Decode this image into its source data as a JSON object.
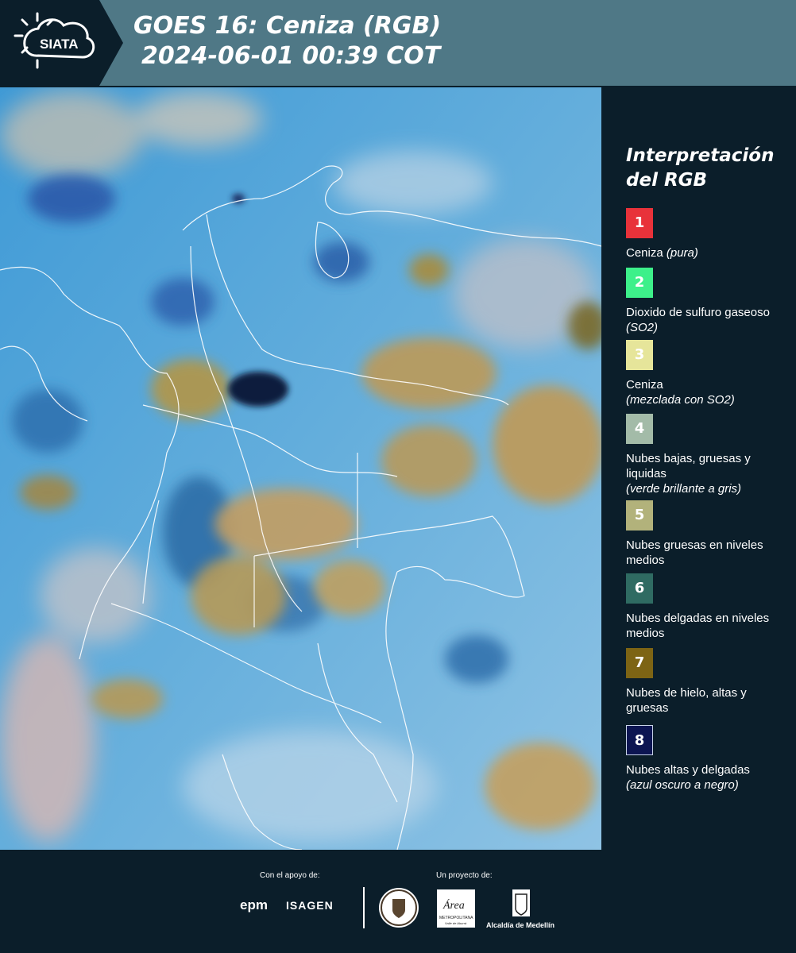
{
  "header": {
    "logo_text": "SIATA",
    "title_line1": "GOES 16: Ceniza (RGB)",
    "title_line2": "2024-06-01 00:39 COT"
  },
  "legend": {
    "title_line1": "Interpretación",
    "title_line2": "del RGB",
    "items": [
      {
        "number": "1",
        "color": "#e8323a",
        "label": "Ceniza ",
        "sub": "(pura)"
      },
      {
        "number": "2",
        "color": "#3df08a",
        "label": "Dioxido de sulfuro gaseoso ",
        "sub": "(SO2)"
      },
      {
        "number": "3",
        "color": "#e6e59a",
        "label": "Ceniza",
        "sub": "(mezclada con SO2)"
      },
      {
        "number": "4",
        "color": "#a3bba8",
        "label": "Nubes bajas, gruesas y liquidas",
        "sub": "(verde brillante a gris)"
      },
      {
        "number": "5",
        "color": "#b2b27b",
        "label": "Nubes gruesas en niveles medios",
        "sub": ""
      },
      {
        "number": "6",
        "color": "#2f6b62",
        "label": "Nubes delgadas en niveles medios",
        "sub": ""
      },
      {
        "number": "7",
        "color": "#7d6414",
        "label": "Nubes de hielo, altas y gruesas",
        "sub": ""
      },
      {
        "number": "8",
        "color": "#0c1552",
        "label": "Nubes altas y delgadas",
        "sub": "(azul oscuro a negro)"
      }
    ]
  },
  "footer": {
    "support_label": "Con el apoyo de:",
    "project_label": "Un proyecto de:",
    "epm": "epm",
    "isagen": "ISAGEN",
    "area_text": "Área",
    "area_sub": "METROPOLITANA",
    "area_sub2": "Valle de Aburrá",
    "alcaldia": "Alcaldía de Medellín"
  },
  "colors": {
    "header_bg": "#4f7886",
    "background": "#0b1e2a",
    "map_base": "#5aa6d6",
    "ice_clouds": "#b69a52",
    "thin_high": "#0c1552"
  }
}
